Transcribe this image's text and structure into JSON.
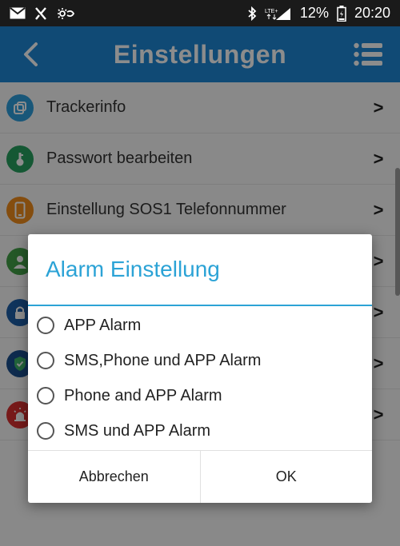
{
  "status_bar": {
    "battery": "12%",
    "time": "20:20",
    "network": "LTE+",
    "icons": [
      "mail-icon",
      "x-icon",
      "sync-icon",
      "bluetooth-icon",
      "signal-icon",
      "battery-icon"
    ]
  },
  "header": {
    "title": "Einstellungen",
    "back_icon": "chevron-left-icon",
    "menu_icon": "list-menu-icon",
    "color": "#1e88d6"
  },
  "list": {
    "items": [
      {
        "label": "Trackerinfo",
        "icon": "tracker-icon",
        "color": "#2f9fdc"
      },
      {
        "label": "Passwort bearbeiten",
        "icon": "key-icon",
        "color": "#27a060"
      },
      {
        "label": "Einstellung SOS1 Telefonnummer",
        "icon": "phone-icon",
        "color": "#f08c1c"
      },
      {
        "label": "",
        "icon": "user-icon",
        "color": "#43a047"
      },
      {
        "label": "",
        "icon": "lock-icon",
        "color": "#1e5fa8"
      },
      {
        "label": "",
        "icon": "shield-icon",
        "color": "#1b4f8f"
      },
      {
        "label": "",
        "icon": "alarm-icon",
        "color": "#d93030"
      }
    ],
    "chevron": ">"
  },
  "dialog": {
    "title": "Alarm Einstellung",
    "accent": "#2ca3d6",
    "options": [
      {
        "label": "APP Alarm"
      },
      {
        "label": "SMS,Phone und APP Alarm"
      },
      {
        "label": "Phone and APP Alarm"
      },
      {
        "label": "SMS und APP Alarm"
      }
    ],
    "cancel_label": "Abbrechen",
    "ok_label": "OK"
  }
}
